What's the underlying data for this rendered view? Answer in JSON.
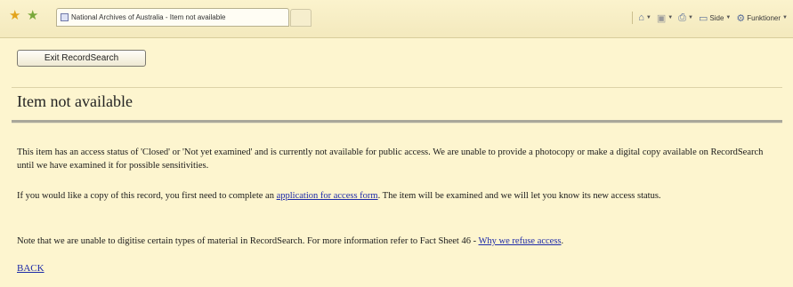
{
  "browser": {
    "tab_title": "National Archives of Australia - Item not available",
    "commands": {
      "page_label": "Side",
      "tools_label": "Funktioner"
    },
    "icons": [
      "favorites-star-icon",
      "add-favorite-icon",
      "home-icon",
      "feeds-icon",
      "print-icon",
      "page-icon",
      "tools-icon"
    ]
  },
  "page": {
    "exit_button_label": "Exit RecordSearch",
    "title": "Item not available",
    "para1": "This item has an access status of 'Closed' or 'Not yet examined' and is currently not available for public access. We are unable to provide a photocopy or make a digital copy available on RecordSearch until we have examined it for possible sensitivities.",
    "para2_before": "If you would like a copy of this record, you first need to complete an ",
    "para2_link": "application for access form",
    "para2_after": ". The item will be examined and we will let you know its new access status.",
    "para3_before": "Note that we are unable to digitise certain types of material in RecordSearch. For more information refer to Fact Sheet 46 - ",
    "para3_link": "Why we refuse access",
    "para3_after": ".",
    "back_label": "BACK"
  },
  "colors": {
    "background": "#fdf5cf",
    "link": "#1d2aa8"
  }
}
